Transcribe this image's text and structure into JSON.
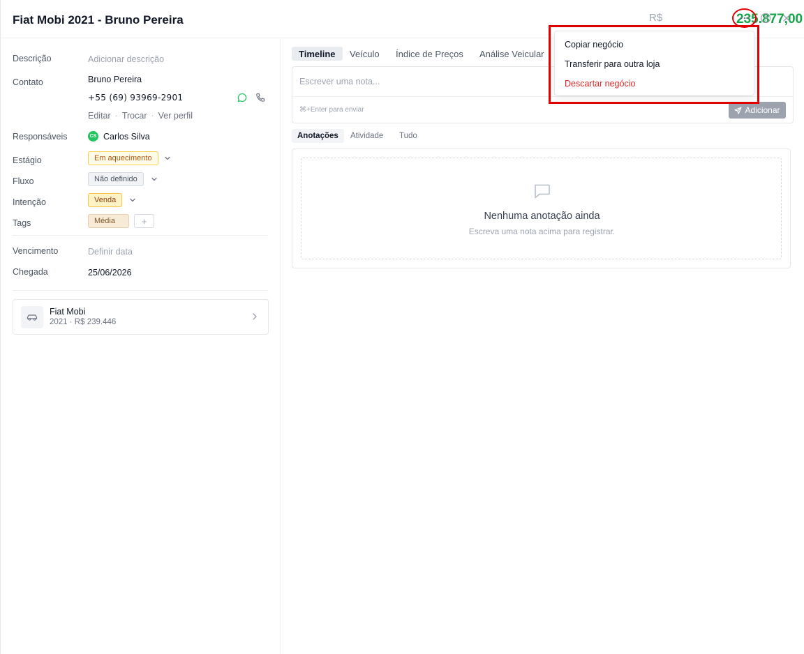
{
  "header": {
    "title": "Fiat Mobi 2021 - Bruno Pereira",
    "price_currency": "R$",
    "price_value": "235.877,00"
  },
  "details": {
    "descricao_label": "Descrição",
    "descricao_placeholder": "Adicionar descrição",
    "contato_label": "Contato",
    "contato_nome": "Bruno Pereira",
    "contato_telefone": "+55 (69) 93969-2901",
    "link_editar": "Editar",
    "link_trocar": "Trocar",
    "link_ver_perfil": "Ver perfil",
    "separator": "·",
    "responsaveis_label": "Responsáveis",
    "responsavel_iniciais": "CS",
    "responsavel_nome": "Carlos Silva",
    "estagio_label": "Estágio",
    "estagio_valor": "Em aquecimento",
    "fluxo_label": "Fluxo",
    "fluxo_valor": "Não definido",
    "intencao_label": "Intenção",
    "intencao_valor": "Venda",
    "tags_label": "Tags",
    "tag_1": "Média",
    "add_tag": "+",
    "vencimento_label": "Vencimento",
    "vencimento_placeholder": "Definir data",
    "chegada_label": "Chegada",
    "chegada_valor": "25/06/2026"
  },
  "vehicle": {
    "name": "Fiat Mobi",
    "subtitle": "2021 · R$ 239.446"
  },
  "tabs": [
    "Timeline",
    "Veículo",
    "Índice de Preços",
    "Análise Veicular"
  ],
  "note": {
    "placeholder": "Escrever uma nota...",
    "hint": "⌘+Enter para enviar",
    "add_label": "Adicionar"
  },
  "subtabs": [
    "Anotações",
    "Atividade",
    "Tudo"
  ],
  "empty_state": {
    "title": "Nenhuma anotação ainda",
    "subtitle": "Escreva uma nota acima para registrar."
  },
  "menu": {
    "items": [
      "Copiar negócio",
      "Transferir para outra loja",
      "Descartar negócio"
    ]
  },
  "colors": {
    "price_green": "#16a34a",
    "danger_red": "#dc2626",
    "annotation_red": "#e10000",
    "whatsapp_green": "#22c55e"
  }
}
